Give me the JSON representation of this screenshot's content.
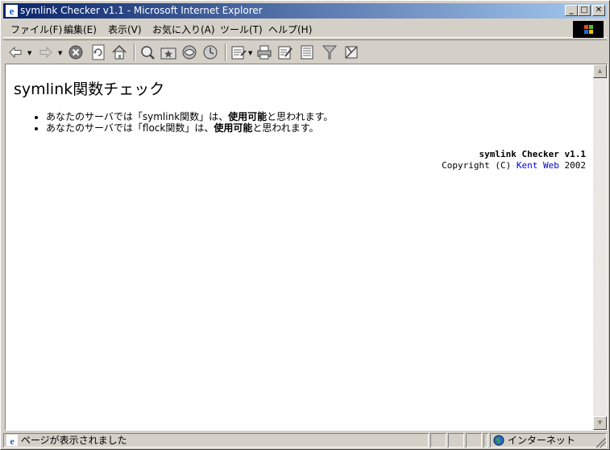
{
  "window": {
    "title": "symlink Checker v1.1 - Microsoft Internet Explorer",
    "controls": {
      "minimize": "_",
      "maximize": "□",
      "close": "✕"
    }
  },
  "menu": {
    "items": [
      "ファイル(F)",
      "編集(E)",
      "表示(V)",
      "お気に入り(A)",
      "ツール(T)",
      "ヘルプ(H)"
    ]
  },
  "toolbar": {
    "buttons": [
      "back-icon",
      "forward-icon",
      "stop-icon",
      "refresh-icon",
      "home-icon",
      "search-icon",
      "favorites-icon",
      "media-icon",
      "history-icon",
      "mail-icon",
      "print-icon",
      "edit-icon",
      "discuss-icon",
      "filter-icon",
      "research-icon"
    ]
  },
  "page": {
    "heading": "symlink関数チェック",
    "items": [
      {
        "prefix": "あなたのサーバでは「symlink関数」は、",
        "bold": "使用可能",
        "suffix": "と思われます。"
      },
      {
        "prefix": "あなたのサーバでは「flock関数」は、",
        "bold": "使用可能",
        "suffix": "と思われます。"
      }
    ],
    "credits": {
      "product": "symlink Checker v1.1",
      "copyright_prefix": "Copyright (C) ",
      "link": "Kent Web",
      "year": " 2002"
    }
  },
  "statusbar": {
    "message": "ページが表示されました",
    "zone": "インターネット"
  },
  "colors": {
    "titlebar_start": "#0a246a",
    "titlebar_end": "#a6caf0",
    "chrome": "#d4d0c8",
    "link": "#0000cc"
  }
}
